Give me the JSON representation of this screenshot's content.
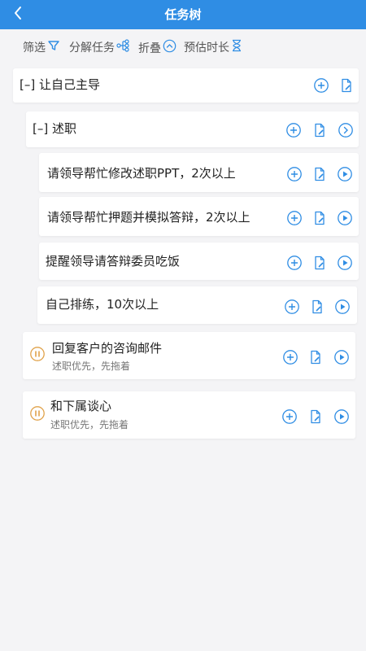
{
  "header": {
    "title": "任务树",
    "back_icon": "chevron-left-icon"
  },
  "toolbar": {
    "filter_label": "筛选",
    "split_label": "分解任务",
    "collapse_label": "折叠",
    "duration_label": "预估时长"
  },
  "colors": {
    "accent": "#2f8de4",
    "pause": "#e0a24a"
  },
  "tasks": [
    {
      "label": "[–] 让自己主导"
    },
    {
      "label": "[–] 述职"
    },
    {
      "label": "请领导帮忙修改述职PPT，2次以上"
    },
    {
      "label": "请领导帮忙押题并模拟答辩，2次以上"
    },
    {
      "label": "提醒领导请答辩委员吃饭"
    },
    {
      "label": "自己排练，10次以上"
    },
    {
      "label": "回复客户的咨询邮件",
      "note": "述职优先，先拖着"
    },
    {
      "label": "和下属谈心",
      "note": "述职优先，先拖着"
    }
  ]
}
